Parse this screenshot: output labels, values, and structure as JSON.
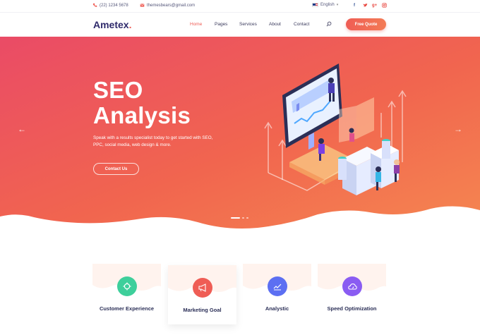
{
  "topbar": {
    "phone": "(22) 1234 5678",
    "email": "themesbears@gmail.com",
    "language": "English",
    "social": {
      "facebook": "f",
      "twitter": "t",
      "google": "g+",
      "instagram": "ig"
    }
  },
  "nav": {
    "logo": "Ametex",
    "logo_dot": ".",
    "items": [
      "Home",
      "Pages",
      "Services",
      "About",
      "Contact"
    ],
    "active_index": 0,
    "cta": "Free Quote"
  },
  "hero": {
    "title_line1": "SEO",
    "title_line2": "Analysis",
    "description": "Speak with a results specialist today to get started with SEO, PPC, social media, web design & more.",
    "button": "Contact Us",
    "slides_total": 3,
    "slide_active": 0
  },
  "features": [
    {
      "label": "Customer Experience",
      "icon": "target-icon",
      "color": "#3ecf9b"
    },
    {
      "label": "Marketing Goal",
      "icon": "megaphone-icon",
      "color": "#ef5d55"
    },
    {
      "label": "Analystic",
      "icon": "chart-line-icon",
      "color": "#5c6ff2"
    },
    {
      "label": "Speed Optimization",
      "icon": "cloud-speed-icon",
      "color": "#8a5cf2"
    }
  ],
  "colors": {
    "accent": "#ef5d55",
    "hero_gradient_start": "#ec5163",
    "hero_gradient_end": "#f47a4f",
    "logo": "#2f2a6b"
  }
}
